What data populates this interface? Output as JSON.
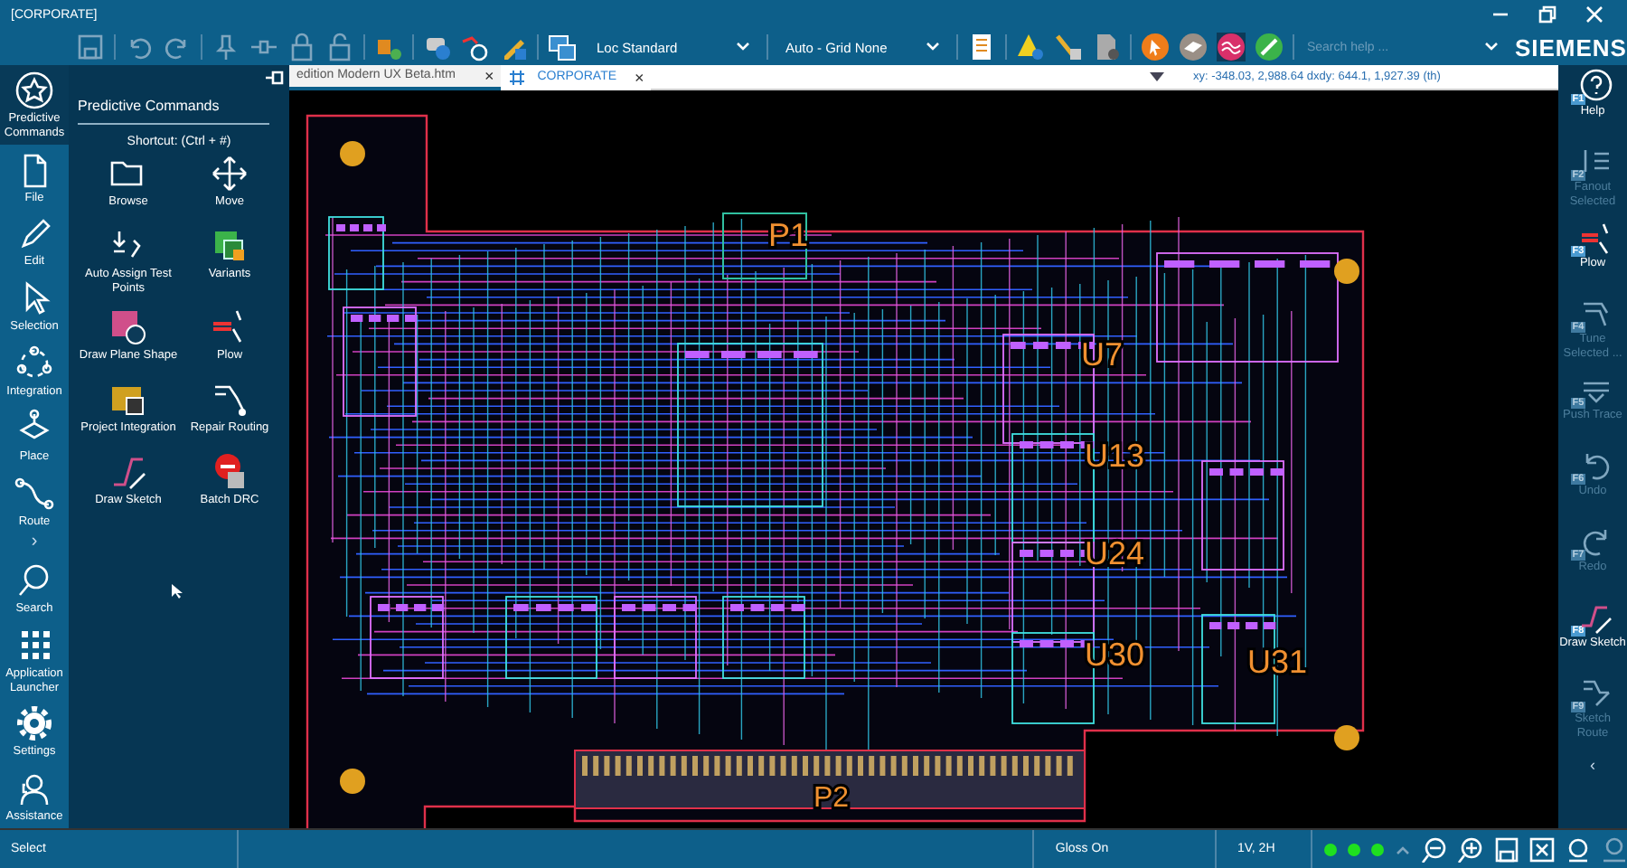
{
  "window": {
    "title": "[CORPORATE]"
  },
  "toolbar": {
    "location_dropdown": "Loc Standard",
    "grid_dropdown": "Auto - Grid None",
    "search": {
      "placeholder": "Search help ..."
    },
    "brand": "SIEMENS"
  },
  "left_rail": {
    "items": [
      {
        "label": "Predictive Commands",
        "selected": true
      },
      {
        "label": "File",
        "selected": false
      },
      {
        "label": "Edit",
        "selected": false
      },
      {
        "label": "Selection",
        "selected": false
      },
      {
        "label": "Integration",
        "selected": false
      },
      {
        "label": "Place",
        "selected": false
      },
      {
        "label": "Route",
        "selected": false
      }
    ],
    "more": "›",
    "bottom_items": [
      {
        "label": "Search"
      },
      {
        "label": "Application Launcher"
      },
      {
        "label": "Settings"
      },
      {
        "label": "Assistance"
      }
    ]
  },
  "panel": {
    "title": "Predictive Commands",
    "shortcut": "Shortcut: (Ctrl + #)",
    "commands": [
      {
        "label": "Browse"
      },
      {
        "label": "Move"
      },
      {
        "label": "Auto Assign Test Points"
      },
      {
        "label": "Variants"
      },
      {
        "label": "Draw Plane Shape"
      },
      {
        "label": "Plow"
      },
      {
        "label": "Project Integration"
      },
      {
        "label": "Repair Routing"
      },
      {
        "label": "Draw Sketch"
      },
      {
        "label": "Batch DRC"
      }
    ]
  },
  "tabs": [
    {
      "label": "edition Modern UX Beta.htm",
      "selected": false,
      "close": "×"
    },
    {
      "label": "CORPORATE",
      "selected": true,
      "close": "×"
    }
  ],
  "coordinates": "xy: -348.03, 2,988.64  dxdy: 644.1, 1,927.39  (th)",
  "canvas": {
    "labels": [
      {
        "text": "P1"
      },
      {
        "text": "U7"
      },
      {
        "text": "U13"
      },
      {
        "text": "U24"
      },
      {
        "text": "U30"
      },
      {
        "text": "U31"
      },
      {
        "text": "P2"
      }
    ]
  },
  "right_rail": {
    "items": [
      {
        "key": "F1",
        "label": "Help",
        "disabled": false
      },
      {
        "key": "F2",
        "label": "Fanout Selected",
        "disabled": true
      },
      {
        "key": "F3",
        "label": "Plow",
        "disabled": false
      },
      {
        "key": "F4",
        "label": "Tune Selected ...",
        "disabled": true
      },
      {
        "key": "F5",
        "label": "Push Trace",
        "disabled": true
      },
      {
        "key": "F6",
        "label": "Undo",
        "disabled": true
      },
      {
        "key": "F7",
        "label": "Redo",
        "disabled": true
      },
      {
        "key": "F8",
        "label": "Draw Sketch",
        "disabled": false
      },
      {
        "key": "F9",
        "label": "Sketch Route",
        "disabled": true
      }
    ],
    "more": "‹"
  },
  "status_bar": {
    "mode": "Select",
    "gloss": "Gloss On",
    "layers": "1V, 2H"
  }
}
